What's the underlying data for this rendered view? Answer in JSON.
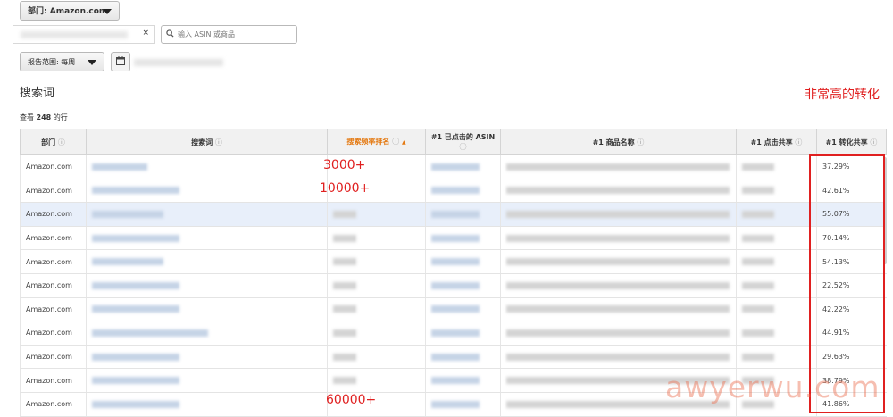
{
  "toolbar": {
    "department_label": "部门: Amazon.com",
    "clear_glyph": "×",
    "search_placeholder": "输入 ASIN 或商品",
    "range_label": "报告范围: 每周"
  },
  "page": {
    "title": "搜索词",
    "rowcount_prefix": "查看",
    "rowcount_value": "248",
    "rowcount_suffix": "的行"
  },
  "table": {
    "headers": [
      "部门",
      "搜索词",
      "搜索频率排名",
      "#1 已点击的 ASIN",
      "#1 商品名称",
      "#1 点击共享",
      "#1 转化共享"
    ],
    "info_glyph": "ⓘ",
    "sort_glyph": "▲",
    "rows": [
      {
        "dept": "Amazon.com",
        "conversion_share": "37.29%"
      },
      {
        "dept": "Amazon.com",
        "conversion_share": "42.61%"
      },
      {
        "dept": "Amazon.com",
        "conversion_share": "55.07%"
      },
      {
        "dept": "Amazon.com",
        "conversion_share": "70.14%"
      },
      {
        "dept": "Amazon.com",
        "conversion_share": "54.13%"
      },
      {
        "dept": "Amazon.com",
        "conversion_share": "22.52%"
      },
      {
        "dept": "Amazon.com",
        "conversion_share": "42.22%"
      },
      {
        "dept": "Amazon.com",
        "conversion_share": "44.91%"
      },
      {
        "dept": "Amazon.com",
        "conversion_share": "29.63%"
      },
      {
        "dept": "Amazon.com",
        "conversion_share": "38.79%"
      },
      {
        "dept": "Amazon.com",
        "conversion_share": "41.86%"
      }
    ]
  },
  "annotations": {
    "note": "非常高的转化",
    "rank_1": "3000+",
    "rank_2": "10000+",
    "rank_3": "60000+",
    "color": "#e02020"
  },
  "watermark": "awyerwu.com"
}
